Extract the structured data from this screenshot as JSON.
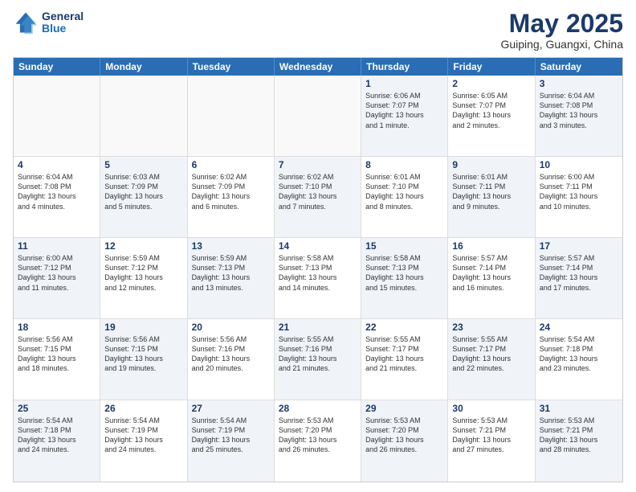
{
  "header": {
    "logo_line1": "General",
    "logo_line2": "Blue",
    "month": "May 2025",
    "location": "Guiping, Guangxi, China"
  },
  "weekdays": [
    "Sunday",
    "Monday",
    "Tuesday",
    "Wednesday",
    "Thursday",
    "Friday",
    "Saturday"
  ],
  "weeks": [
    [
      {
        "day": "",
        "text": "",
        "empty": true
      },
      {
        "day": "",
        "text": "",
        "empty": true
      },
      {
        "day": "",
        "text": "",
        "empty": true
      },
      {
        "day": "",
        "text": "",
        "empty": true
      },
      {
        "day": "1",
        "text": "Sunrise: 6:06 AM\nSunset: 7:07 PM\nDaylight: 13 hours\nand 1 minute.",
        "empty": false
      },
      {
        "day": "2",
        "text": "Sunrise: 6:05 AM\nSunset: 7:07 PM\nDaylight: 13 hours\nand 2 minutes.",
        "empty": false
      },
      {
        "day": "3",
        "text": "Sunrise: 6:04 AM\nSunset: 7:08 PM\nDaylight: 13 hours\nand 3 minutes.",
        "empty": false
      }
    ],
    [
      {
        "day": "4",
        "text": "Sunrise: 6:04 AM\nSunset: 7:08 PM\nDaylight: 13 hours\nand 4 minutes.",
        "empty": false
      },
      {
        "day": "5",
        "text": "Sunrise: 6:03 AM\nSunset: 7:09 PM\nDaylight: 13 hours\nand 5 minutes.",
        "empty": false
      },
      {
        "day": "6",
        "text": "Sunrise: 6:02 AM\nSunset: 7:09 PM\nDaylight: 13 hours\nand 6 minutes.",
        "empty": false
      },
      {
        "day": "7",
        "text": "Sunrise: 6:02 AM\nSunset: 7:10 PM\nDaylight: 13 hours\nand 7 minutes.",
        "empty": false
      },
      {
        "day": "8",
        "text": "Sunrise: 6:01 AM\nSunset: 7:10 PM\nDaylight: 13 hours\nand 8 minutes.",
        "empty": false
      },
      {
        "day": "9",
        "text": "Sunrise: 6:01 AM\nSunset: 7:11 PM\nDaylight: 13 hours\nand 9 minutes.",
        "empty": false
      },
      {
        "day": "10",
        "text": "Sunrise: 6:00 AM\nSunset: 7:11 PM\nDaylight: 13 hours\nand 10 minutes.",
        "empty": false
      }
    ],
    [
      {
        "day": "11",
        "text": "Sunrise: 6:00 AM\nSunset: 7:12 PM\nDaylight: 13 hours\nand 11 minutes.",
        "empty": false
      },
      {
        "day": "12",
        "text": "Sunrise: 5:59 AM\nSunset: 7:12 PM\nDaylight: 13 hours\nand 12 minutes.",
        "empty": false
      },
      {
        "day": "13",
        "text": "Sunrise: 5:59 AM\nSunset: 7:13 PM\nDaylight: 13 hours\nand 13 minutes.",
        "empty": false
      },
      {
        "day": "14",
        "text": "Sunrise: 5:58 AM\nSunset: 7:13 PM\nDaylight: 13 hours\nand 14 minutes.",
        "empty": false
      },
      {
        "day": "15",
        "text": "Sunrise: 5:58 AM\nSunset: 7:13 PM\nDaylight: 13 hours\nand 15 minutes.",
        "empty": false
      },
      {
        "day": "16",
        "text": "Sunrise: 5:57 AM\nSunset: 7:14 PM\nDaylight: 13 hours\nand 16 minutes.",
        "empty": false
      },
      {
        "day": "17",
        "text": "Sunrise: 5:57 AM\nSunset: 7:14 PM\nDaylight: 13 hours\nand 17 minutes.",
        "empty": false
      }
    ],
    [
      {
        "day": "18",
        "text": "Sunrise: 5:56 AM\nSunset: 7:15 PM\nDaylight: 13 hours\nand 18 minutes.",
        "empty": false
      },
      {
        "day": "19",
        "text": "Sunrise: 5:56 AM\nSunset: 7:15 PM\nDaylight: 13 hours\nand 19 minutes.",
        "empty": false
      },
      {
        "day": "20",
        "text": "Sunrise: 5:56 AM\nSunset: 7:16 PM\nDaylight: 13 hours\nand 20 minutes.",
        "empty": false
      },
      {
        "day": "21",
        "text": "Sunrise: 5:55 AM\nSunset: 7:16 PM\nDaylight: 13 hours\nand 21 minutes.",
        "empty": false
      },
      {
        "day": "22",
        "text": "Sunrise: 5:55 AM\nSunset: 7:17 PM\nDaylight: 13 hours\nand 21 minutes.",
        "empty": false
      },
      {
        "day": "23",
        "text": "Sunrise: 5:55 AM\nSunset: 7:17 PM\nDaylight: 13 hours\nand 22 minutes.",
        "empty": false
      },
      {
        "day": "24",
        "text": "Sunrise: 5:54 AM\nSunset: 7:18 PM\nDaylight: 13 hours\nand 23 minutes.",
        "empty": false
      }
    ],
    [
      {
        "day": "25",
        "text": "Sunrise: 5:54 AM\nSunset: 7:18 PM\nDaylight: 13 hours\nand 24 minutes.",
        "empty": false
      },
      {
        "day": "26",
        "text": "Sunrise: 5:54 AM\nSunset: 7:19 PM\nDaylight: 13 hours\nand 24 minutes.",
        "empty": false
      },
      {
        "day": "27",
        "text": "Sunrise: 5:54 AM\nSunset: 7:19 PM\nDaylight: 13 hours\nand 25 minutes.",
        "empty": false
      },
      {
        "day": "28",
        "text": "Sunrise: 5:53 AM\nSunset: 7:20 PM\nDaylight: 13 hours\nand 26 minutes.",
        "empty": false
      },
      {
        "day": "29",
        "text": "Sunrise: 5:53 AM\nSunset: 7:20 PM\nDaylight: 13 hours\nand 26 minutes.",
        "empty": false
      },
      {
        "day": "30",
        "text": "Sunrise: 5:53 AM\nSunset: 7:21 PM\nDaylight: 13 hours\nand 27 minutes.",
        "empty": false
      },
      {
        "day": "31",
        "text": "Sunrise: 5:53 AM\nSunset: 7:21 PM\nDaylight: 13 hours\nand 28 minutes.",
        "empty": false
      }
    ]
  ]
}
